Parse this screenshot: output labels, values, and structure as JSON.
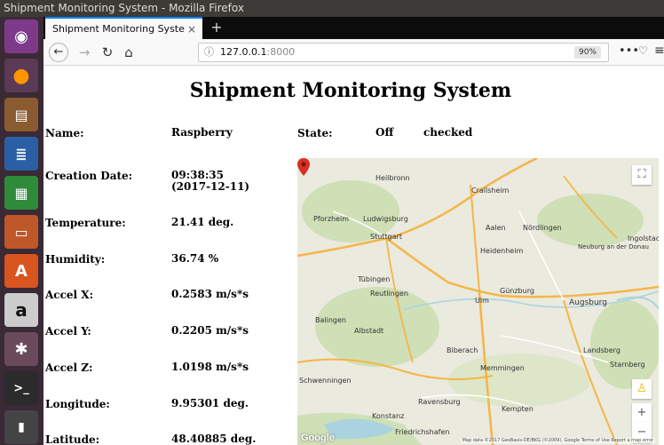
{
  "window": {
    "title": "Shipment Monitoring System - Mozilla Firefox"
  },
  "browser": {
    "tab_title": "Shipment Monitoring Syste",
    "tab_close": "×",
    "new_tab": "+",
    "url_host": "127.0.0.1",
    "url_port": ":8000",
    "zoom": "90%",
    "more": "•••",
    "menu": "≡"
  },
  "page": {
    "title": "Shipment Monitoring System",
    "fields": [
      {
        "label": "Name:",
        "value": "Raspberry"
      },
      {
        "label": "Creation Date:",
        "value_line1": "09:38:35",
        "value_line2": "(2017-12-11)"
      },
      {
        "label": "Temperature:",
        "value": "21.41 deg."
      },
      {
        "label": "Humidity:",
        "value": "36.74 %"
      },
      {
        "label": "Accel X:",
        "value": "0.2583 m/s*s"
      },
      {
        "label": "Accel Y:",
        "value": "0.2205 m/s*s"
      },
      {
        "label": "Accel Z:",
        "value": "1.0198 m/s*s"
      },
      {
        "label": "Longitude:",
        "value": "9.95301 deg."
      },
      {
        "label": "Latitude:",
        "value": "48.40885 deg."
      }
    ],
    "state_label": "State:",
    "state_value": "Off",
    "checked_text": "checked"
  },
  "map": {
    "cities": [
      "Heilbronn",
      "Crailsheim",
      "Pforzheim",
      "Ludwigsburg",
      "Aalen",
      "Nördlingen",
      "Stuttgart",
      "Heidenheim",
      "Neuburg an der Donau",
      "Ingolstadt",
      "Tübingen",
      "Reutlingen",
      "Günzburg",
      "Ulm",
      "Augsburg",
      "Balingen",
      "Albstadt",
      "Biberach",
      "Schwenningen",
      "Memmingen",
      "Landsberg",
      "Starnberg",
      "Ravensburg",
      "Kempten",
      "Konstanz",
      "Friedrichshafen"
    ],
    "google": "Google",
    "attribution": "Map data ©2017 GeoBasis-DE/BKG (©2009), Google  Terms of Use  Report a map error"
  },
  "colors": {
    "pin": "#d93025",
    "road_major": "#f6b547",
    "road_minor": "#ffffff",
    "forest": "#cfdfb6",
    "water": "#aad3df"
  }
}
